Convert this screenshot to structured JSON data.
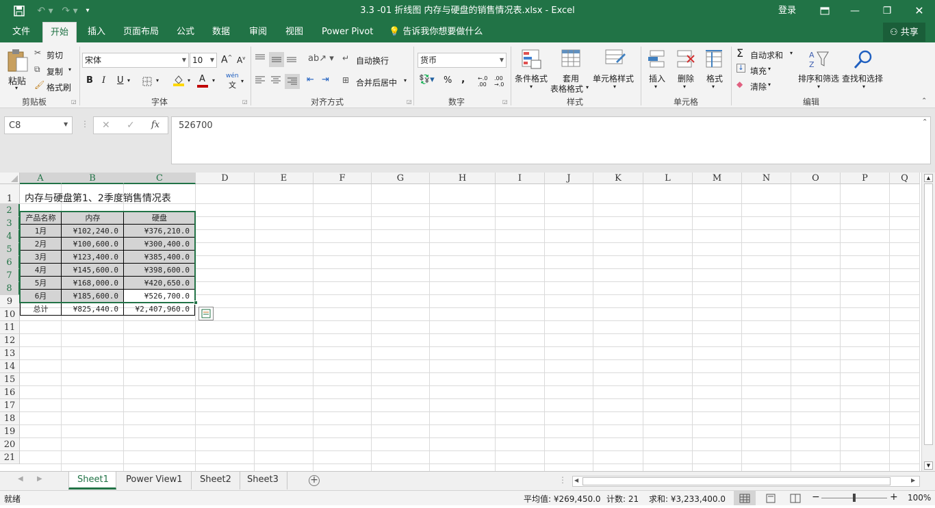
{
  "window": {
    "title": "3.3 -01 折线图 内存与硬盘的销售情况表.xlsx  -  Excel",
    "login": "登录"
  },
  "ribbon_tabs": [
    {
      "label": "文件"
    },
    {
      "label": "开始"
    },
    {
      "label": "插入"
    },
    {
      "label": "页面布局"
    },
    {
      "label": "公式"
    },
    {
      "label": "数据"
    },
    {
      "label": "审阅"
    },
    {
      "label": "视图"
    },
    {
      "label": "Power Pivot"
    }
  ],
  "tellme": "告诉我你想要做什么",
  "share": "共享",
  "clipboard": {
    "paste": "粘贴",
    "cut": "剪切",
    "copy": "复制",
    "format_painter": "格式刷",
    "group": "剪贴板"
  },
  "font": {
    "name": "宋体",
    "size": "10",
    "bold": "B",
    "italic": "I",
    "underline": "U",
    "group": "字体",
    "wen": "wén",
    "font_color": "#c00000",
    "fill_color": "#ffd700"
  },
  "alignment": {
    "wrap": "自动换行",
    "merge": "合并后居中",
    "group": "对齐方式"
  },
  "number": {
    "format": "货币",
    "percent": "%",
    "comma": ",",
    "inc": "←.0 .00",
    "dec": ".00 →.0",
    "group": "数字"
  },
  "styles": {
    "conditional": "条件格式",
    "table_fmt_1": "套用",
    "table_fmt_2": "表格格式",
    "cell_styles": "单元格样式",
    "group": "样式"
  },
  "cells": {
    "insert": "插入",
    "delete": "删除",
    "format": "格式",
    "group": "单元格"
  },
  "editing": {
    "autosum": "自动求和",
    "fill": "填充",
    "clear": "清除",
    "sort": "排序和筛选",
    "find": "查找和选择",
    "group": "编辑"
  },
  "formula_bar": {
    "name_box": "C8",
    "fx": "fx",
    "value": "526700"
  },
  "columns": [
    "A",
    "B",
    "C",
    "D",
    "E",
    "F",
    "G",
    "H",
    "I",
    "J",
    "K",
    "L",
    "M",
    "N",
    "O",
    "P",
    "Q"
  ],
  "rows": [
    "1",
    "2",
    "3",
    "4",
    "5",
    "6",
    "7",
    "8",
    "9",
    "10",
    "11",
    "12",
    "13",
    "14",
    "15",
    "16",
    "17",
    "18",
    "19",
    "20",
    "21"
  ],
  "table": {
    "title": "内存与硬盘第1、2季度销售情况表",
    "headers": [
      "产品名称",
      "内存",
      "硬盘"
    ],
    "data": [
      [
        "1月",
        "¥102,240.0",
        "¥376,210.0"
      ],
      [
        "2月",
        "¥100,600.0",
        "¥300,400.0"
      ],
      [
        "3月",
        "¥123,400.0",
        "¥385,400.0"
      ],
      [
        "4月",
        "¥145,600.0",
        "¥398,600.0"
      ],
      [
        "5月",
        "¥168,000.0",
        "¥420,650.0"
      ],
      [
        "6月",
        "¥185,600.0",
        "¥526,700.0"
      ]
    ],
    "total": [
      "总计",
      "¥825,440.0",
      "¥2,407,960.0"
    ]
  },
  "sheets": [
    {
      "label": "Sheet1"
    },
    {
      "label": "Power View1"
    },
    {
      "label": "Sheet2"
    },
    {
      "label": "Sheet3"
    }
  ],
  "status": {
    "ready": "就绪",
    "average": "平均值: ¥269,450.0",
    "count": "计数: 21",
    "sum": "求和: ¥3,233,400.0",
    "zoom": "100%"
  }
}
